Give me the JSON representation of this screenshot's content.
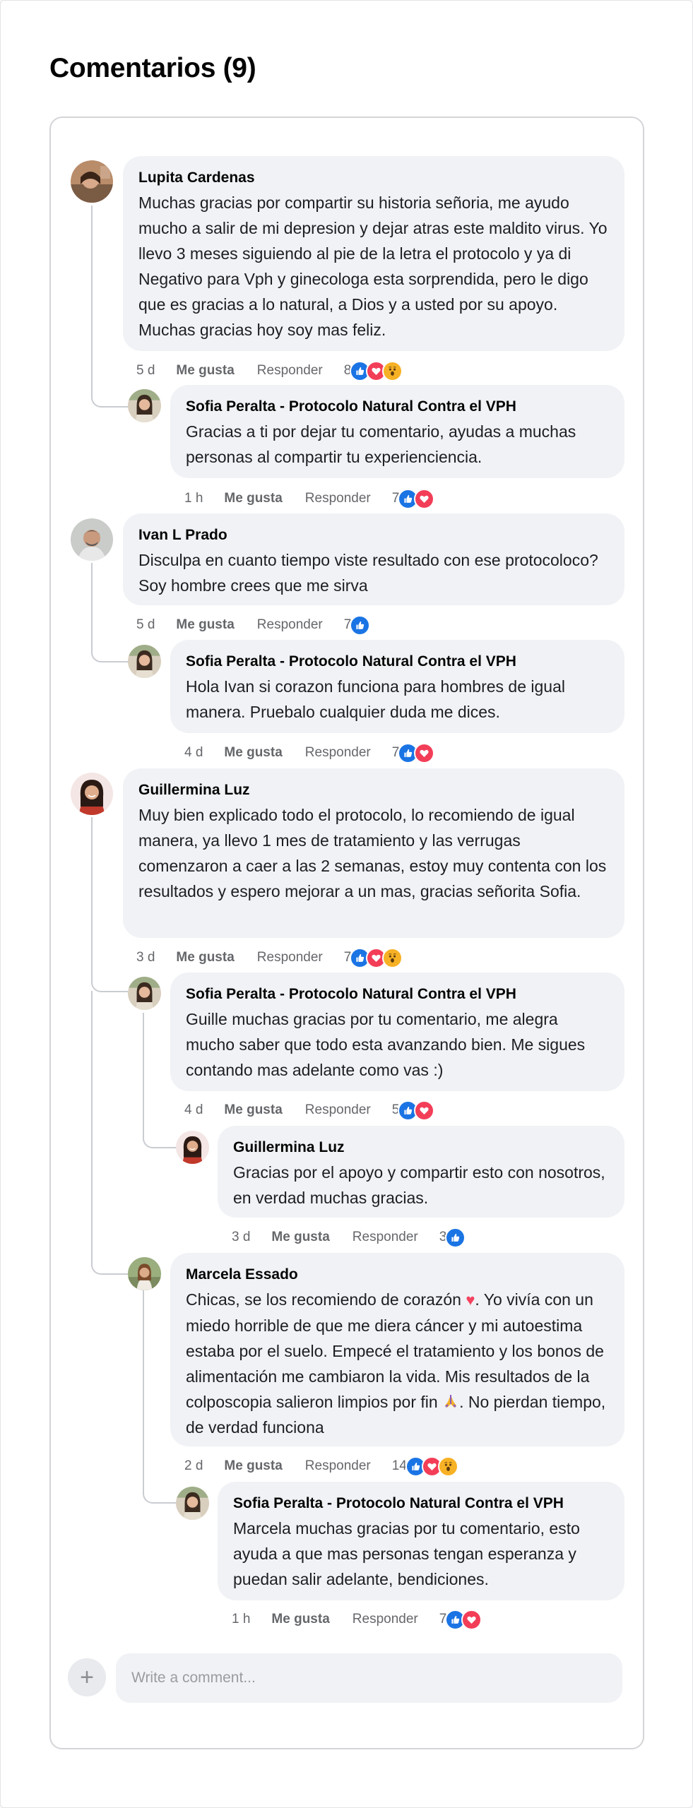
{
  "section_title": "Comentarios (9)",
  "comments": [
    {
      "author": "Lupita Cardenas",
      "text": "Muchas gracias por compartir su historia señoria, me ayudo mucho a salir de mi depresion y dejar atras este maldito virus. Yo llevo 3 meses siguiendo al pie de la letra el protocolo y ya di Negativo para Vph y ginecologa esta sorprendida, pero le digo que es gracias a lo natural, a Dios y a usted por su apoyo. Muchas gracias hoy soy mas feliz.",
      "time": "5 d",
      "like_label": "Me gusta",
      "reply_label": "Responder",
      "reaction_count": "8",
      "reactions": [
        "like-icon",
        "love-icon",
        "wow-icon"
      ]
    },
    {
      "author": "Sofia Peralta - Protocolo Natural Contra el VPH",
      "text": "Gracias a ti por dejar tu comentario, ayudas a muchas personas al compartir tu experienciencia.",
      "time": "1 h",
      "like_label": "Me gusta",
      "reply_label": "Responder",
      "reaction_count": "7",
      "reactions": [
        "like-icon",
        "love-icon"
      ]
    },
    {
      "author": "Ivan L Prado",
      "text": "Disculpa en cuanto tiempo viste resultado con ese protocoloco? Soy hombre crees que me sirva",
      "time": "5 d",
      "like_label": "Me gusta",
      "reply_label": "Responder",
      "reaction_count": "7",
      "reactions": [
        "like-icon"
      ]
    },
    {
      "author": "Sofia Peralta - Protocolo Natural Contra el VPH",
      "text": "Hola Ivan si corazon funciona para hombres de igual manera. Pruebalo cualquier duda me dices.",
      "time": "4 d",
      "like_label": "Me gusta",
      "reply_label": "Responder",
      "reaction_count": "7",
      "reactions": [
        "like-icon",
        "love-icon"
      ]
    },
    {
      "author": "Guillermina Luz",
      "text": "Muy bien explicado todo el protocolo, lo recomiendo de igual manera, ya llevo 1 mes de tratamiento y las verrugas comenzaron a caer a las 2 semanas, estoy muy contenta con los resultados y espero mejorar a un mas, gracias señorita Sofia.",
      "time": "3 d",
      "like_label": "Me gusta",
      "reply_label": "Responder",
      "reaction_count": "7",
      "reactions": [
        "like-icon",
        "love-icon",
        "wow-icon"
      ]
    },
    {
      "author": "Sofia Peralta - Protocolo Natural Contra el VPH",
      "text": "Guille muchas gracias por tu comentario, me alegra mucho saber que todo esta avanzando bien. Me sigues contando mas adelante como vas :)",
      "time": "4 d",
      "like_label": "Me gusta",
      "reply_label": "Responder",
      "reaction_count": "5",
      "reactions": [
        "like-icon",
        "love-icon"
      ]
    },
    {
      "author": "Guillermina Luz",
      "text": "Gracias por el apoyo y compartir esto con nosotros, en verdad muchas gracias.",
      "time": "3 d",
      "like_label": "Me gusta",
      "reply_label": "Responder",
      "reaction_count": "3",
      "reactions": [
        "like-icon"
      ]
    },
    {
      "author": "Marcela Essado",
      "text_part1": "Chicas, se los recomiendo de corazón ",
      "text_part2": ". Yo vivía con un miedo horrible de que me diera cáncer y mi autoestima estaba por el suelo. Empecé el tratamiento y los bonos de alimentación me cambiaron la vida. Mis resultados de la colposcopia salieron limpios por fin ",
      "text_part3": ". No pierdan tiempo, de verdad funciona",
      "heart_emoji": "♥",
      "time": "2 d",
      "like_label": "Me gusta",
      "reply_label": "Responder",
      "reaction_count": "14",
      "reactions": [
        "like-icon",
        "love-icon",
        "wow-icon"
      ]
    },
    {
      "author": "Sofia Peralta - Protocolo Natural Contra el VPH",
      "text": "Marcela muchas gracias por tu comentario, esto ayuda a que mas personas tengan esperanza y puedan salir adelante, bendiciones.",
      "time": "1 h",
      "like_label": "Me gusta",
      "reply_label": "Responder",
      "reaction_count": "7",
      "reactions": [
        "like-icon",
        "love-icon"
      ]
    }
  ],
  "composer": {
    "placeholder": "Write a comment...",
    "add_icon": "plus-icon"
  },
  "colors": {
    "like": "#1b74e4",
    "love": "#f33e58",
    "wow": "#f7b125",
    "bubble": "#f0f2f5"
  }
}
